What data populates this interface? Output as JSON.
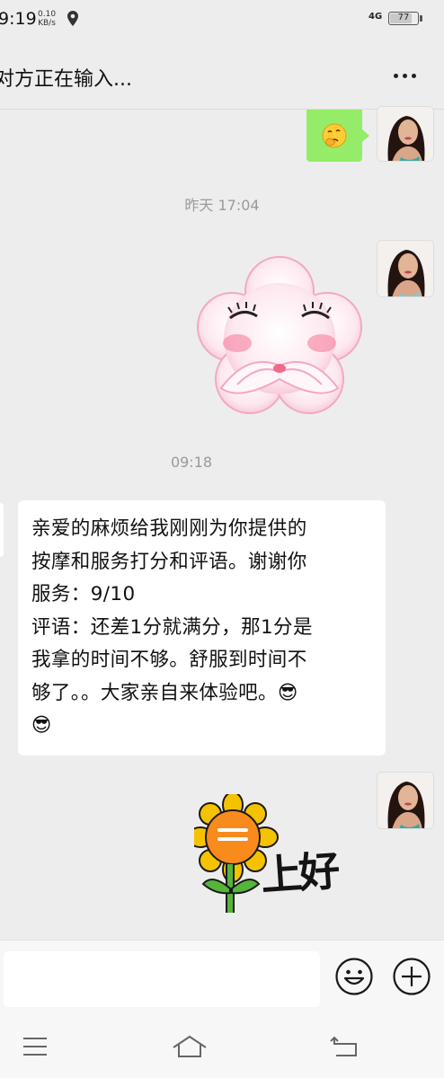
{
  "status_bar": {
    "time": "9:19",
    "speed_value": "0.10",
    "speed_unit": "KB/s",
    "network": "4G",
    "battery": "77"
  },
  "header": {
    "title": "对方正在输入...",
    "more_icon": "more-dots-icon"
  },
  "messages": {
    "timestamp_1": "昨天 17:04",
    "timestamp_2": "09:18",
    "emoji_bubble_icon": "thinking-face-emoji-icon",
    "sticker_1": "pink-flower-shy-sticker",
    "text_message": [
      "亲爱的麻烦给我刚刚为你提供的",
      "按摩和服务打分和评语。谢谢你",
      "服务：9/10",
      "评语：还差1分就满分，那1分是",
      "我拿的时间不够。舒服到时间不",
      "够了。。大家亲自来体验吧。😎",
      "😎"
    ],
    "sticker_2": "sunflower-greeting-sticker",
    "sticker_2_text": "上好"
  },
  "input_bar": {
    "placeholder": "",
    "emoji_icon": "smiley-icon",
    "plus_icon": "plus-icon"
  },
  "nav_bar": {
    "menu_icon": "menu-icon",
    "home_icon": "home-icon",
    "back_icon": "back-icon"
  },
  "colors": {
    "background": "#ededed",
    "sent_bubble": "#95ec69",
    "received_bubble": "#ffffff",
    "timestamp_text": "#9a9a9a"
  }
}
